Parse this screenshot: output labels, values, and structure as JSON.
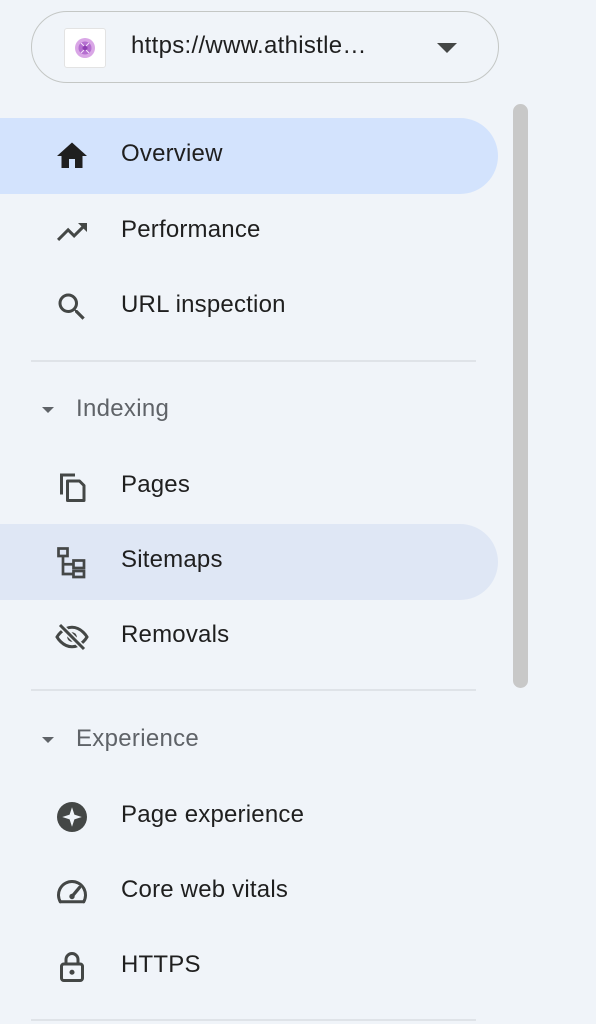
{
  "property": {
    "url": "https://www.athistle…",
    "favicon_icon": "site-favicon",
    "dropdown_icon": "arrow-drop-down-icon"
  },
  "nav": {
    "overview": {
      "label": "Overview",
      "icon": "home-icon"
    },
    "performance": {
      "label": "Performance",
      "icon": "trending-up-icon"
    },
    "url_inspection": {
      "label": "URL inspection",
      "icon": "search-icon"
    }
  },
  "sections": {
    "indexing": {
      "label": "Indexing",
      "items": {
        "pages": {
          "label": "Pages",
          "icon": "pages-copy-icon"
        },
        "sitemaps": {
          "label": "Sitemaps",
          "icon": "sitemap-icon"
        },
        "removals": {
          "label": "Removals",
          "icon": "visibility-off-icon"
        }
      }
    },
    "experience": {
      "label": "Experience",
      "items": {
        "page_experience": {
          "label": "Page experience",
          "icon": "sparkle-badge-icon"
        },
        "core_web_vitals": {
          "label": "Core web vitals",
          "icon": "speed-gauge-icon"
        },
        "https": {
          "label": "HTTPS",
          "icon": "lock-icon"
        }
      }
    }
  },
  "colors": {
    "background": "#f0f4f9",
    "active_item": "#d3e3fd",
    "hover_item": "#dfe7f5",
    "icon": "#444746",
    "section_label": "#5f6368"
  }
}
